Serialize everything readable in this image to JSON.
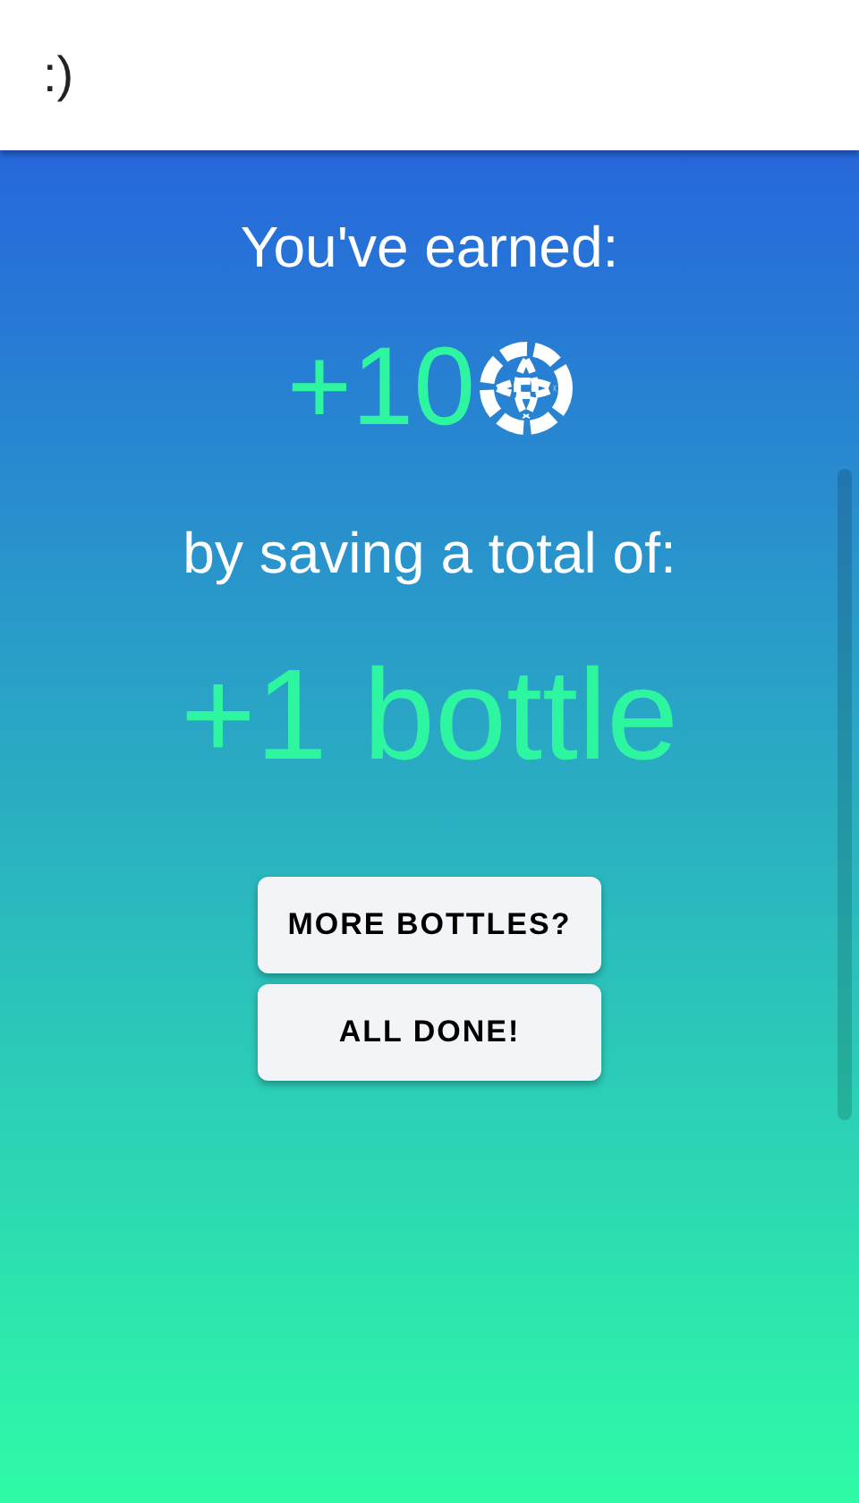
{
  "header": {
    "title": ":)"
  },
  "earned": {
    "label": "You've earned:",
    "amount": "+10"
  },
  "saved": {
    "label": "by saving a total of:",
    "amount": "+1 bottle"
  },
  "buttons": [
    {
      "label": "MORE BOTTLES?"
    },
    {
      "label": "ALL DONE!"
    }
  ]
}
